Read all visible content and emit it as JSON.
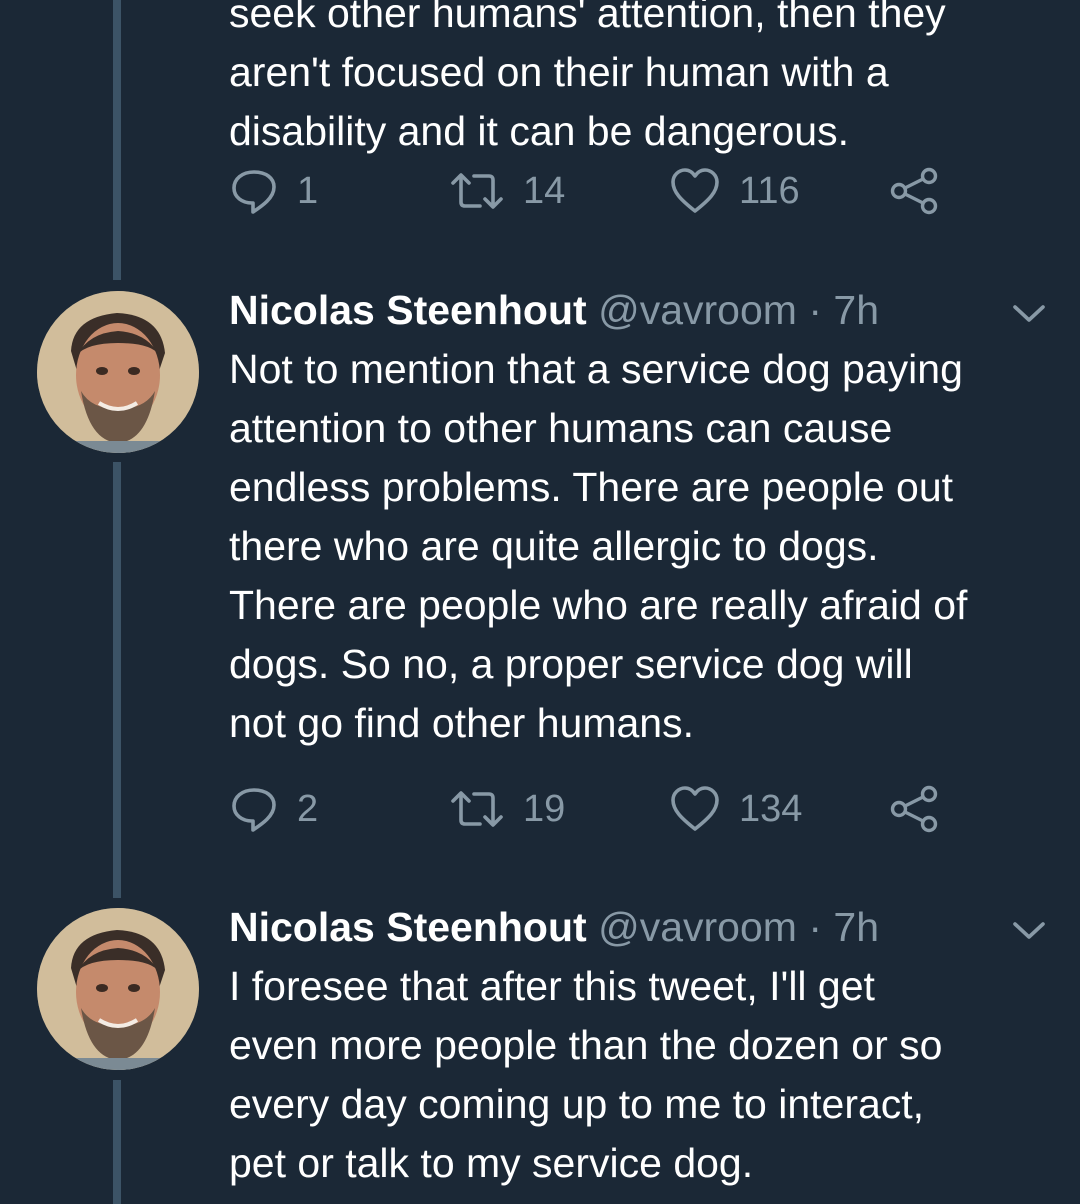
{
  "thread": {
    "top_tweet": {
      "text_partial": "seek other humans' attention, then they\naren't focused on their human with a\ndisability and it can be dangerous.",
      "replies": "1",
      "retweets": "14",
      "likes": "116"
    },
    "tweets": [
      {
        "author_name": "Nicolas Steenhout",
        "handle": "@vavroom",
        "separator": "·",
        "time": "7h",
        "text": "Not to mention that a service dog paying\nattention to other humans can cause\nendless problems. There are people out\nthere who are quite allergic to dogs.\nThere are people who are really afraid of\ndogs. So no, a proper service dog will\nnot go find other humans.",
        "replies": "2",
        "retweets": "19",
        "likes": "134"
      },
      {
        "author_name": "Nicolas Steenhout",
        "handle": "@vavroom",
        "separator": "·",
        "time": "7h",
        "text": "I foresee that after this tweet, I'll get\neven more people than the dozen or so\nevery day coming up to me to interact,\npet or talk to my service dog."
      }
    ]
  },
  "icons": {
    "reply": "reply-icon",
    "retweet": "retweet-icon",
    "like": "heart-icon",
    "share": "share-icon",
    "caret": "chevron-down-icon"
  },
  "colors": {
    "background": "#1b2836",
    "thread_line": "#3c5366",
    "text": "#ffffff",
    "secondary": "#8899a6"
  }
}
